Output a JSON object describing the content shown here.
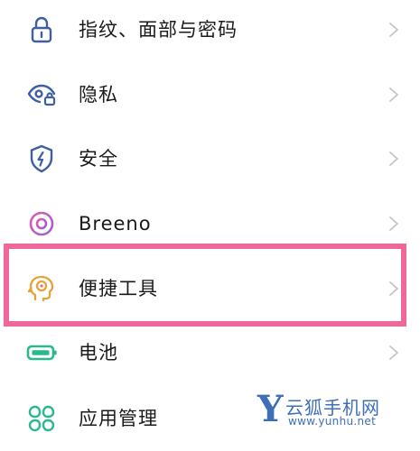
{
  "settings": {
    "items": [
      {
        "label": "指纹、面部与密码",
        "icon": "lock-icon",
        "color": "#3e5fa0"
      },
      {
        "label": "隐私",
        "icon": "privacy-eye-icon",
        "color": "#3e5fa0"
      },
      {
        "label": "安全",
        "icon": "shield-icon",
        "color": "#3e5fa0"
      },
      {
        "label": "Breeno",
        "icon": "breeno-icon",
        "color": "#c45cc9"
      },
      {
        "label": "便捷工具",
        "icon": "head-tools-icon",
        "color": "#e8a23a"
      },
      {
        "label": "电池",
        "icon": "battery-icon",
        "color": "#2cb88e"
      },
      {
        "label": "应用管理",
        "icon": "app-grid-icon",
        "color": "#2cb88e"
      }
    ]
  },
  "highlight": {
    "color": "#f0679a"
  },
  "watermark": {
    "letter": "Y",
    "name": "云狐手机网",
    "url": "www.yunhu.net"
  }
}
